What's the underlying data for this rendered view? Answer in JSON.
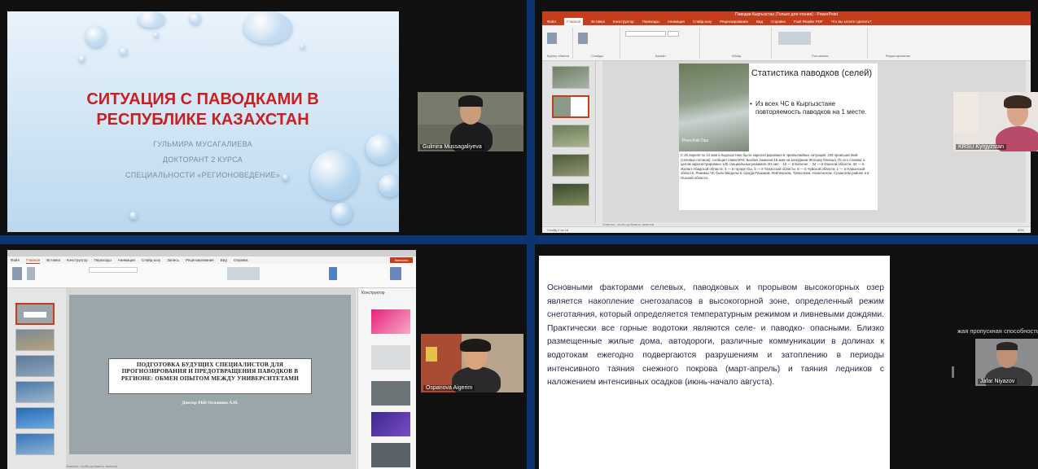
{
  "tiles": {
    "t1": {
      "slide": {
        "title_line1": "СИТУАЦИЯ С ПАВОДКАМИ В",
        "title_line2": "РЕСПУБЛИКЕ КАЗАХСТАН",
        "author": "ГУЛЬМИРА МУСАГАЛИЕВА",
        "role": "ДОКТОРАНТ 2 КУРСА",
        "specialty": "СПЕЦИАЛЬНОСТИ «РЕГИОНОВЕДЕНИЕ»"
      },
      "participant": "Gulmira Mussagaliyeva"
    },
    "t2": {
      "window_title": "Паводки Кыргызстан (Только для чтения) - PowerPoint",
      "menu": [
        "Файл",
        "Главная",
        "Вставка",
        "Конструктор",
        "Переходы",
        "Анимация",
        "Слайд-шоу",
        "Рецензирование",
        "Вид",
        "Справка",
        "Foxit Reader PDF",
        "Что вы хотите сделать?"
      ],
      "ribbon_groups": [
        "Буфер обмена",
        "Слайды",
        "Шрифт",
        "Абзац",
        "Рисование",
        "Редактирование"
      ],
      "slide": {
        "title": "Статистика паводков (селей)",
        "bullet": "Из всех ЧС в Кыргызстане повторяемость паводков на 1 месте.",
        "photo_caption": "Река Кой-Таш",
        "body": "С 20 апреля по 12 мая в Кыргызстане было зарегистрировано 6 чрезвычайных ситуаций, 106 происшествий (селевых потоков), сообщил глава МЧС Бообек Ажикеев 15 мая на заседании Жогорку Кенеша. По его словам, в целом зарегистрировано 125 специальных режимов. Из них: - 10 — в Баткене, - 34 — в Ошской области, 34 — в Жалал-Абадской области, 3 — в городе Ош, 5 — в Таласской области, 8 — в Чуйской области, 1 — в Нарынской области. Режимы ЧС были введены в города Раззаков, Лейлекском, Таласском, Ноокенском, Сузакском районе и в Ошской области."
      },
      "notes": "Заметки, чтобы добавить заметки",
      "status": "Слайд 2 из 16",
      "zoom": "83%",
      "participant": "KRSU Kyrgyzstan"
    },
    "t3": {
      "menu": [
        "Файл",
        "Главная",
        "Вставка",
        "Конструктор",
        "Переходы",
        "Анимация",
        "Слайд-шоу",
        "Запись",
        "Рецензирование",
        "Вид",
        "Справка"
      ],
      "record_label": "Записать",
      "slide": {
        "title": "ПОДГОТОВКА БУДУЩИХ СПЕЦИАЛИСТОВ ДЛЯ ПРОГНОЗИРОВАНИЯ И ПРЕДОТВРАЩЕНИЯ ПАВОДКОВ В РЕГИОНЕ: ОБМЕН ОПЫТОМ МЕЖДУ УНИВЕРСИТЕТАМИ",
        "author": "Доктор PhD Оспанова А.Н."
      },
      "notes": "Заметки, чтобы добавить заметки",
      "designer_title": "Конструктор",
      "participant": "Ospanova Aigerim"
    },
    "t4": {
      "slide": {
        "text": "Основными факторами селевых, паводковых и прорывом высокогорных озер является накопление снегозапасов в высокогорной зоне, определенный режим снеготаяния, который определяется температурным режимом и ливневыми дождями. Практически все горные водотоки являются селе- и паводко- опасными. Близко размещенные жилые дома, автодороги, различные коммуникации в долинах к водотокам ежегодно подвергаются разрушениям и затоплению в периоды интенсивного таяния снежного покрова (март-апрель) и таяния ледников с наложением интенсивных осадков (июнь-начало августа)."
      },
      "caption": "жая пропускная способность",
      "participant": "Jafar Niyazov"
    }
  },
  "colors": {
    "background": "#0b3470",
    "title_red": "#c8201e",
    "ppt_accent": "#c43e1c"
  }
}
